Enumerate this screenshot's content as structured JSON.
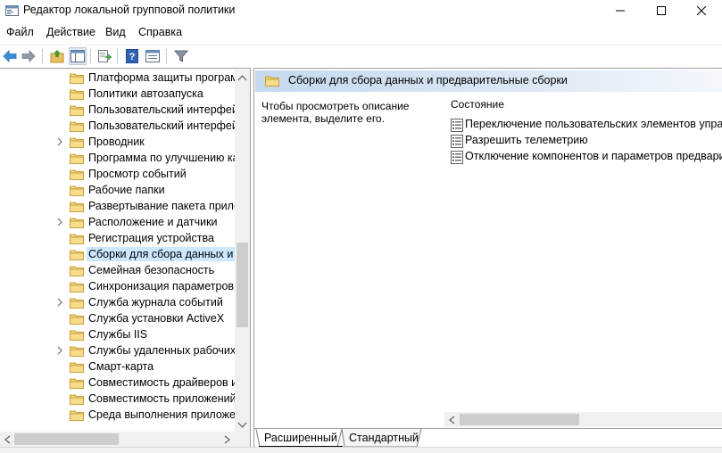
{
  "window": {
    "title": "Редактор локальной групповой политики"
  },
  "menu": {
    "items": [
      "Файл",
      "Действие",
      "Вид",
      "Справка"
    ]
  },
  "toolbar": {
    "buttons": [
      "back-arrow-icon",
      "forward-arrow-icon",
      "up-folder-icon",
      "show-hide-tree-icon",
      "export-list-icon",
      "help-icon",
      "properties-icon",
      "filter-icon"
    ]
  },
  "tree": {
    "items": [
      {
        "label": "Платформа защиты програми",
        "expandable": false
      },
      {
        "label": "Политики автозапуска",
        "expandable": false
      },
      {
        "label": "Пользовательский интерфейс",
        "expandable": false
      },
      {
        "label": "Пользовательский интерфейс",
        "expandable": false
      },
      {
        "label": "Проводник",
        "expandable": true
      },
      {
        "label": "Программа по улучшению ка",
        "expandable": false
      },
      {
        "label": "Просмотр событий",
        "expandable": false
      },
      {
        "label": "Рабочие папки",
        "expandable": false
      },
      {
        "label": "Развертывание пакета прило",
        "expandable": false
      },
      {
        "label": "Расположение и датчики",
        "expandable": true
      },
      {
        "label": "Регистрация устройства",
        "expandable": false
      },
      {
        "label": "Сборки для сбора данных и п",
        "expandable": false,
        "selected": true
      },
      {
        "label": "Семейная безопасность",
        "expandable": false
      },
      {
        "label": "Синхронизация параметров",
        "expandable": false
      },
      {
        "label": "Служба журнала событий",
        "expandable": true
      },
      {
        "label": "Служба установки ActiveX",
        "expandable": false
      },
      {
        "label": "Службы IIS",
        "expandable": false
      },
      {
        "label": "Службы удаленных рабочих с",
        "expandable": true
      },
      {
        "label": "Смарт-карта",
        "expandable": false
      },
      {
        "label": "Совместимость драйверов и у",
        "expandable": false
      },
      {
        "label": "Совместимость приложений",
        "expandable": false
      },
      {
        "label": "Среда выполнения приложен",
        "expandable": false
      }
    ]
  },
  "details": {
    "header_title": "Сборки для сбора данных и предварительные сборки",
    "description": "Чтобы просмотреть описание элемента, выделите его.",
    "column_header": "Состояние",
    "policies": [
      "Переключение пользовательских элементов управл",
      "Разрешить телеметрию",
      "Отключение компонентов и параметров предварито"
    ]
  },
  "tabs": {
    "extended": "Расширенный",
    "standard": "Стандартный"
  },
  "colors": {
    "selection": "#cce8ff",
    "header_gradient_start": "#c5d9ef",
    "folder": "#e8c063"
  }
}
